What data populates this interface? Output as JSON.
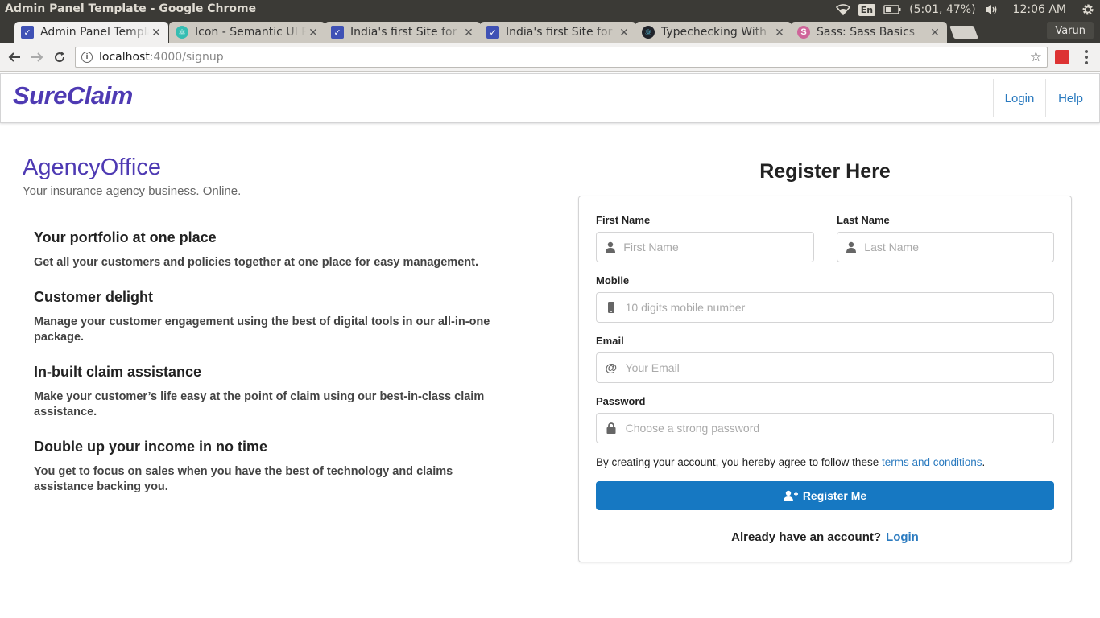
{
  "os": {
    "window_title": "Admin Panel Template - Google Chrome",
    "lang": "En",
    "battery": "(5:01, 47%)",
    "time": "12:06 AM"
  },
  "tabs": [
    {
      "title": "Admin Panel Template",
      "favicon": "checkbox-icon",
      "color": "#3f51b5",
      "active": true
    },
    {
      "title": "Icon - Semantic UI React",
      "favicon": "react-icon",
      "color": "#35bdb2",
      "active": false
    },
    {
      "title": "India's first Site for",
      "favicon": "checkbox-icon",
      "color": "#3f51b5",
      "active": false
    },
    {
      "title": "India's first Site for",
      "favicon": "checkbox-icon",
      "color": "#3f51b5",
      "active": false
    },
    {
      "title": "Typechecking With",
      "favicon": "react-icon",
      "color": "#20232a",
      "active": false
    },
    {
      "title": "Sass: Sass Basics",
      "favicon": "sass-icon",
      "color": "#cf649a",
      "active": false
    }
  ],
  "profile": "Varun",
  "address": {
    "host": "localhost",
    "path": ":4000/signup"
  },
  "app": {
    "brand": "SureClaim",
    "nav": {
      "login": "Login",
      "help": "Help"
    },
    "brand_color": "#4e3ab3",
    "accent_color": "#1678c2"
  },
  "agency": {
    "title": "AgencyOffice",
    "subtitle": "Your insurance agency business. Online."
  },
  "features": [
    {
      "title": "Your portfolio at one place",
      "body": "Get all your customers and policies together at one place for easy management."
    },
    {
      "title": "Customer delight",
      "body": "Manage your customer engagement using the best of digital tools in our all-in-one package."
    },
    {
      "title": "In-built claim assistance",
      "body": "Make your customer’s life easy at the point of claim using our best-in-class claim assistance."
    },
    {
      "title": "Double up your income in no time",
      "body": "You get to focus on sales when you have the best of technology and claims assistance backing you."
    }
  ],
  "form": {
    "heading": "Register Here",
    "first_name": {
      "label": "First Name",
      "placeholder": "First Name",
      "icon": "user-icon"
    },
    "last_name": {
      "label": "Last Name",
      "placeholder": "Last Name",
      "icon": "user-icon"
    },
    "mobile": {
      "label": "Mobile",
      "placeholder": "10 digits mobile number",
      "icon": "mobile-icon"
    },
    "email": {
      "label": "Email",
      "placeholder": "Your Email",
      "icon": "at-icon"
    },
    "password": {
      "label": "Password",
      "placeholder": "Choose a strong password",
      "icon": "lock-icon"
    },
    "agree_prefix": "By creating your account, you hereby agree to follow these ",
    "agree_link": "terms and conditions",
    "agree_suffix": ".",
    "submit": "Register Me",
    "already": "Already have an account?",
    "login_link": "Login"
  }
}
